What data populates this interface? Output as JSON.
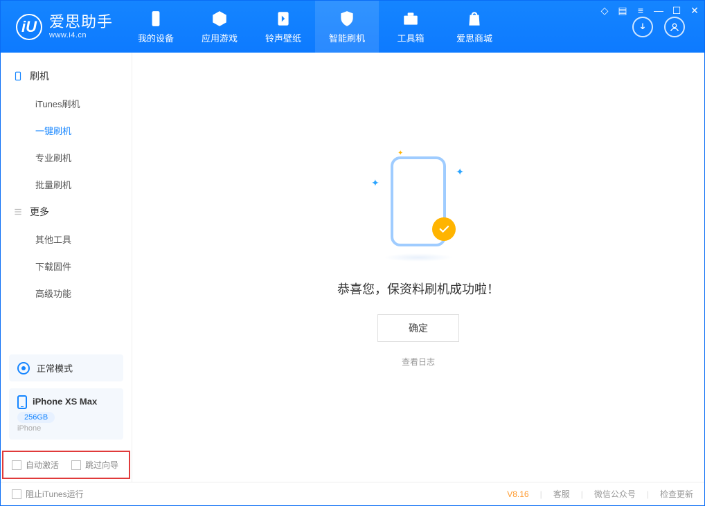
{
  "app": {
    "name": "爱思助手",
    "url": "www.i4.cn"
  },
  "tabs": {
    "device": "我的设备",
    "apps": "应用游戏",
    "ringtone": "铃声壁纸",
    "flash": "智能刷机",
    "toolbox": "工具箱",
    "store": "爱思商城"
  },
  "sidebar": {
    "group1": "刷机",
    "items1": {
      "itunes": "iTunes刷机",
      "oneclick": "一键刷机",
      "pro": "专业刷机",
      "batch": "批量刷机"
    },
    "group2": "更多",
    "items2": {
      "other": "其他工具",
      "firmware": "下载固件",
      "advanced": "高级功能"
    }
  },
  "mode": {
    "label": "正常模式"
  },
  "device": {
    "name": "iPhone XS Max",
    "storage": "256GB",
    "type": "iPhone"
  },
  "options": {
    "autoActivate": "自动激活",
    "skipGuide": "跳过向导"
  },
  "main": {
    "success": "恭喜您，保资料刷机成功啦！",
    "ok": "确定",
    "viewLog": "查看日志"
  },
  "footer": {
    "blockItunes": "阻止iTunes运行",
    "version": "V8.16",
    "support": "客服",
    "wechat": "微信公众号",
    "update": "检查更新"
  }
}
